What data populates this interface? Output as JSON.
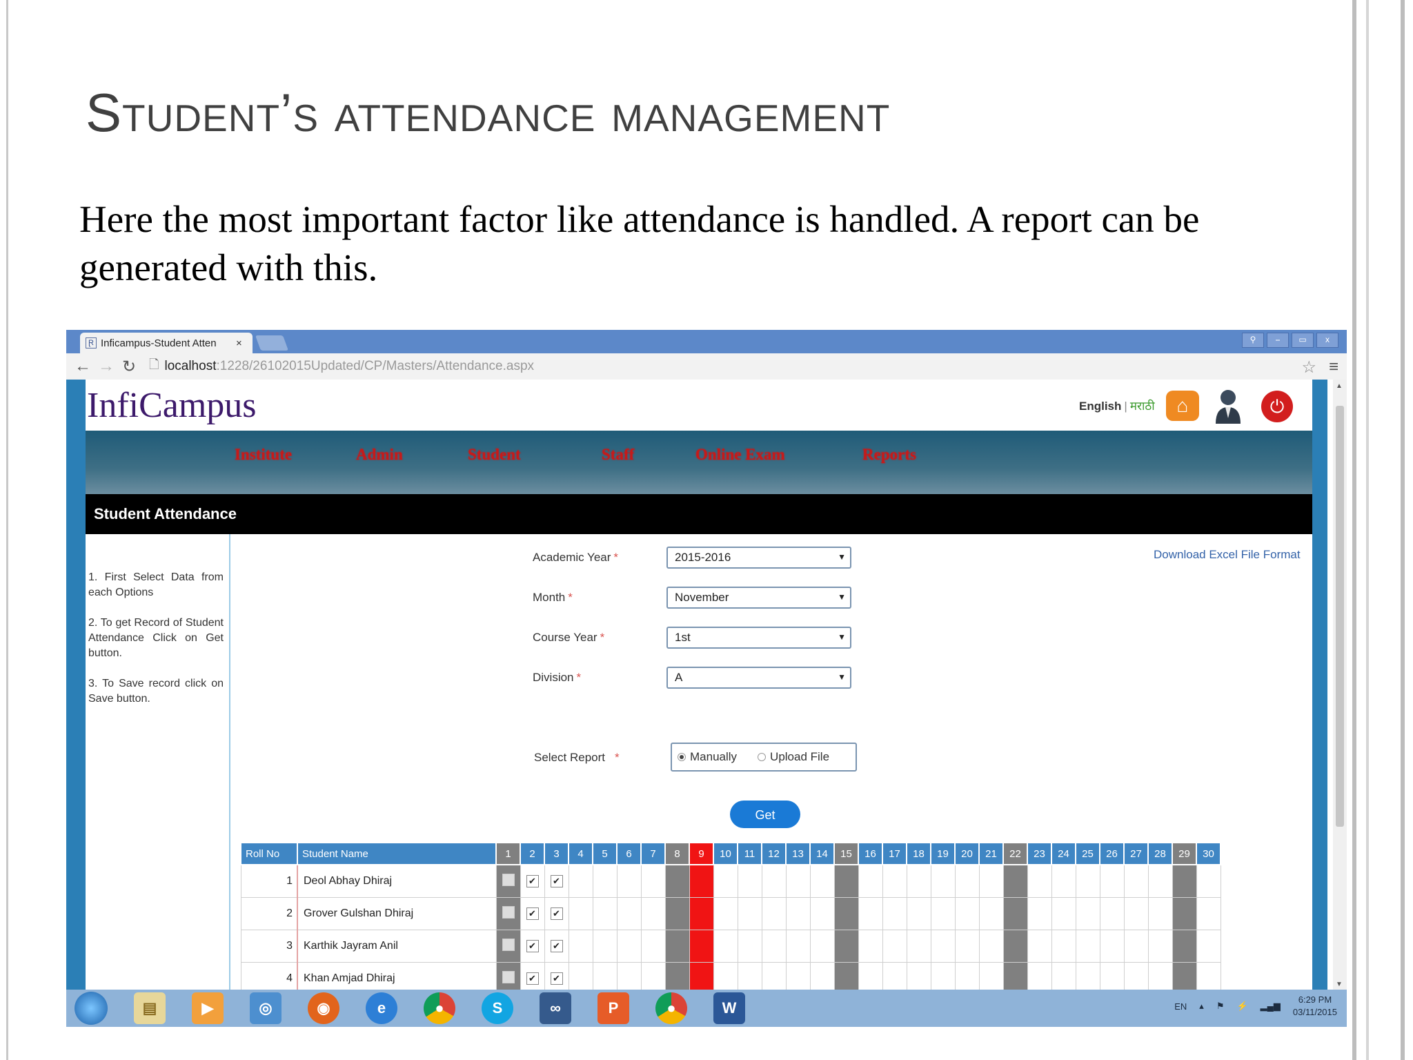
{
  "slide": {
    "title": "Student’s attendance management",
    "body": "Here the most important factor like attendance is handled. A report can be generated with this."
  },
  "browser": {
    "tab_title": "Inficampus-Student Atten",
    "tab_close": "×",
    "url_host": "localhost",
    "url_path": ":1228/26102015Updated/CP/Masters/Attendance.aspx",
    "window_controls": [
      "⎯",
      "▭",
      "x"
    ]
  },
  "app": {
    "logo": "InfiCampus",
    "lang_english": "English",
    "lang_sep": "|",
    "lang_marathi": "मराठी",
    "nav": [
      "Institute",
      "Admin",
      "Student",
      "Staff",
      "Online Exam",
      "Reports"
    ],
    "section_title": "Student Attendance",
    "help": [
      "1. First Select Data from each Options",
      "2. To get Record of Student Attendance Click on Get button.",
      "3. To Save record click on Save button."
    ],
    "download_link": "Download Excel File Format",
    "form": {
      "academic_year_label": "Academic Year",
      "academic_year_value": "2015-2016",
      "month_label": "Month",
      "month_value": "November",
      "course_year_label": "Course Year",
      "course_year_value": "1st",
      "division_label": "Division",
      "division_value": "A",
      "required_mark": "*",
      "select_report_label": "Select Report",
      "report_manual": "Manually",
      "report_upload": "Upload File",
      "get_button": "Get"
    },
    "grid": {
      "headers": [
        "Roll No",
        "Student Name"
      ],
      "days": [
        "1",
        "2",
        "3",
        "4",
        "5",
        "6",
        "7",
        "8",
        "9",
        "10",
        "11",
        "12",
        "13",
        "14",
        "15",
        "16",
        "17",
        "18",
        "19",
        "20",
        "21",
        "22",
        "23",
        "24",
        "25",
        "26",
        "27",
        "28",
        "29",
        "30"
      ],
      "gray_days": [
        1,
        8,
        15,
        22,
        29
      ],
      "red_days": [
        9
      ],
      "rows": [
        {
          "roll": "1",
          "name": "Deol Abhay Dhiraj",
          "checked": [
            2,
            3
          ]
        },
        {
          "roll": "2",
          "name": "Grover Gulshan Dhiraj",
          "checked": [
            2,
            3
          ]
        },
        {
          "roll": "3",
          "name": "Karthik Jayram Anil",
          "checked": [
            2,
            3
          ]
        },
        {
          "roll": "4",
          "name": "Khan Amjad Dhiraj",
          "checked": [
            2,
            3
          ]
        }
      ],
      "accent_colors": {
        "header": "#3f86c4",
        "holiday": "#808080",
        "today": "#f01414"
      }
    }
  },
  "taskbar": {
    "lang": "EN",
    "time": "6:29 PM",
    "date": "03/11/2015"
  }
}
